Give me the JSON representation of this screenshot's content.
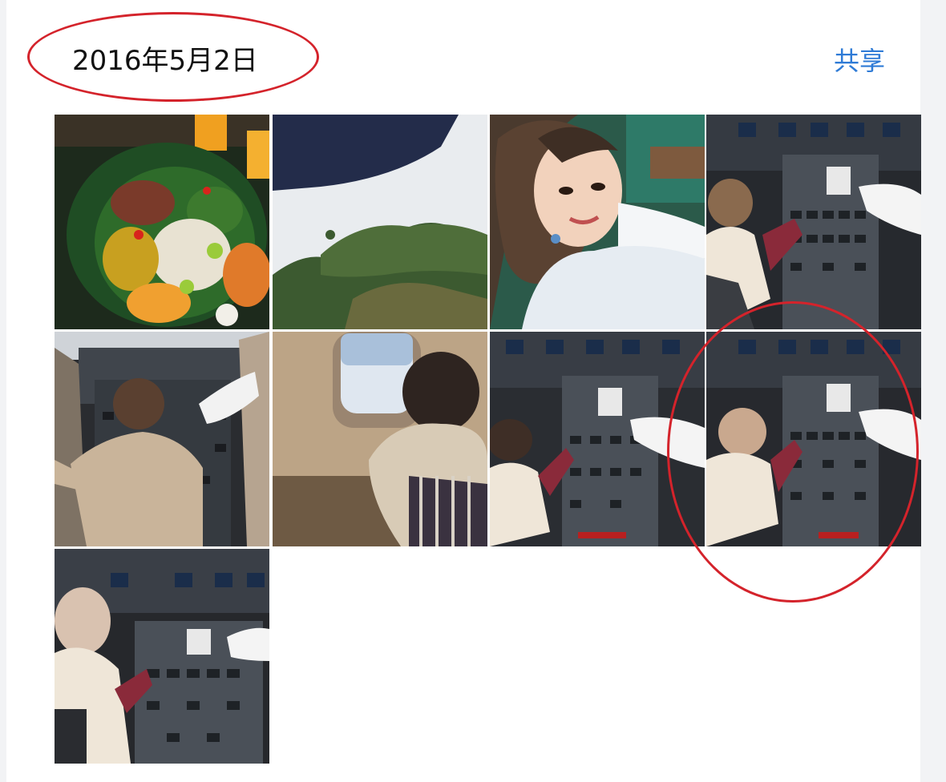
{
  "header": {
    "date": "2016年5月2日",
    "share_label": "共享"
  },
  "photos": [
    {
      "subject": "food-platter"
    },
    {
      "subject": "sky-trees-from-window"
    },
    {
      "subject": "woman-selfie"
    },
    {
      "subject": "child-in-cockpit-seat"
    },
    {
      "subject": "child-standing-in-cockpit"
    },
    {
      "subject": "child-at-aircraft-window"
    },
    {
      "subject": "child-in-cockpit-seat"
    },
    {
      "subject": "child-in-cockpit-seat-highlighted"
    },
    {
      "subject": "child-in-cockpit-seat-closeup"
    }
  ],
  "colors": {
    "annotation": "#d4232b",
    "accent": "#2f7bd6"
  }
}
